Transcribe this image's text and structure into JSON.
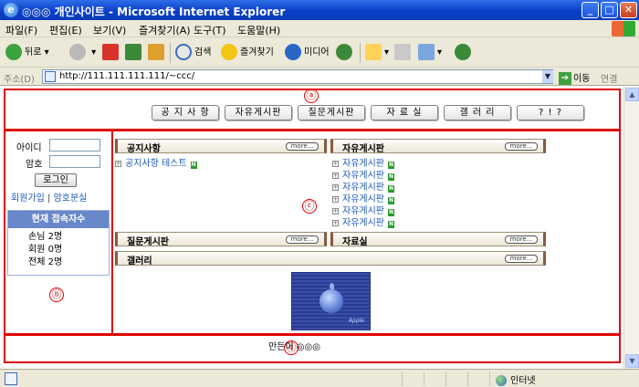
{
  "window": {
    "title": "◎◎◎ 개인사이트 - Microsoft Internet Explorer"
  },
  "menu": [
    "파일(F)",
    "편집(E)",
    "보기(V)",
    "즐겨찾기(A)",
    "도구(T)",
    "도움말(H)"
  ],
  "toolbar": {
    "back": "뒤로",
    "search": "검색",
    "favorites": "즐겨찾기",
    "media": "미디어"
  },
  "address": {
    "label": "주소(D)",
    "url": "http://111.111.111.111/~ccc/",
    "go": "이동",
    "links": "연결"
  },
  "annotations": {
    "a": "ⓐ",
    "b": "ⓑ",
    "c": "ⓒ",
    "d": "ⓓ"
  },
  "nav": [
    "공 지 사 항",
    "자유게시판",
    "질문게시판",
    "자  료  실",
    "갤  러  리",
    "? ! ?"
  ],
  "login": {
    "id_label": "아이디",
    "pw_label": "암호",
    "button": "로그인",
    "join": "회원가입",
    "sep": "|",
    "lost": "암호분실"
  },
  "users": {
    "title": "현재 접속자수",
    "guest": "손님  2명",
    "member": "회원  0명",
    "total": "전체  2명"
  },
  "boards": {
    "notice": {
      "title": "공지사항",
      "more": "more..."
    },
    "free": {
      "title": "자유게시판",
      "more": "more..."
    },
    "qna": {
      "title": "질문게시판",
      "more": "more..."
    },
    "files": {
      "title": "자료실",
      "more": "more..."
    },
    "gallery": {
      "title": "갤러리",
      "more": "more..."
    }
  },
  "notice_posts": [
    "공지사항 테스트"
  ],
  "free_posts": [
    "자유게시판",
    "자유게시판",
    "자유게시판",
    "자유게시판",
    "자유게시판",
    "자유게시판"
  ],
  "new_badge": "N",
  "bullet": "+",
  "banner": {
    "logo": "Apple"
  },
  "footer": {
    "text": "만든이 ◎◎◎"
  },
  "status": {
    "zone": "인터넷"
  }
}
